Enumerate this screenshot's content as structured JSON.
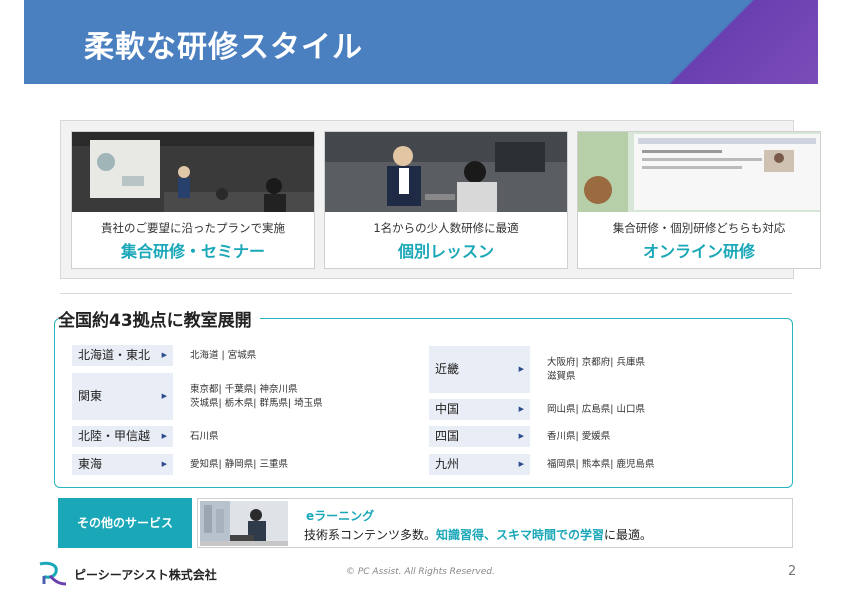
{
  "header": {
    "title": "柔軟な研修スタイル"
  },
  "styles": [
    {
      "subtitle": "貴社のご要望に沿ったプランで実施",
      "title": "集合研修・セミナー"
    },
    {
      "subtitle": "1名からの少人数研修に最適",
      "title": "個別レッスン"
    },
    {
      "subtitle": "集合研修・個別研修どちらも対応",
      "title": "オンライン研修"
    }
  ],
  "locations": {
    "title": "全国約43拠点に教室展開",
    "left": [
      {
        "region": "北海道・東北",
        "prefs": [
          "北海道 | 宮城県"
        ]
      },
      {
        "region": "関東",
        "prefs": [
          "東京都| 千葉県| 神奈川県",
          "茨城県| 栃木県| 群馬県| 埼玉県"
        ]
      },
      {
        "region": "北陸・甲信越",
        "prefs": [
          "石川県"
        ]
      },
      {
        "region": "東海",
        "prefs": [
          "愛知県| 静岡県| 三重県"
        ]
      }
    ],
    "right": [
      {
        "region": "近畿",
        "prefs": [
          "大阪府| 京都府| 兵庫県",
          "滋賀県"
        ]
      },
      {
        "region": "中国",
        "prefs": [
          "岡山県| 広島県| 山口県"
        ]
      },
      {
        "region": "四国",
        "prefs": [
          "香川県| 愛媛県"
        ]
      },
      {
        "region": "九州",
        "prefs": [
          "福岡県| 熊本県| 鹿児島県"
        ]
      }
    ],
    "arrow_icon": "triangle-right-icon"
  },
  "services": {
    "label": "その他のサービス",
    "name": "eラーニング",
    "desc_pre": "技術系コンテンツ多数。",
    "desc_hl": "知識習得、スキマ時間での学習",
    "desc_post": "に最適。"
  },
  "footer": {
    "company": "ピーシーアシスト株式会社",
    "copyright": "© PC Assist. All Rights Reserved.",
    "page": "2"
  },
  "colors": {
    "banner": "#4a7fc0",
    "accent": "#1aa7b8",
    "purple": "#6a3fb0"
  }
}
